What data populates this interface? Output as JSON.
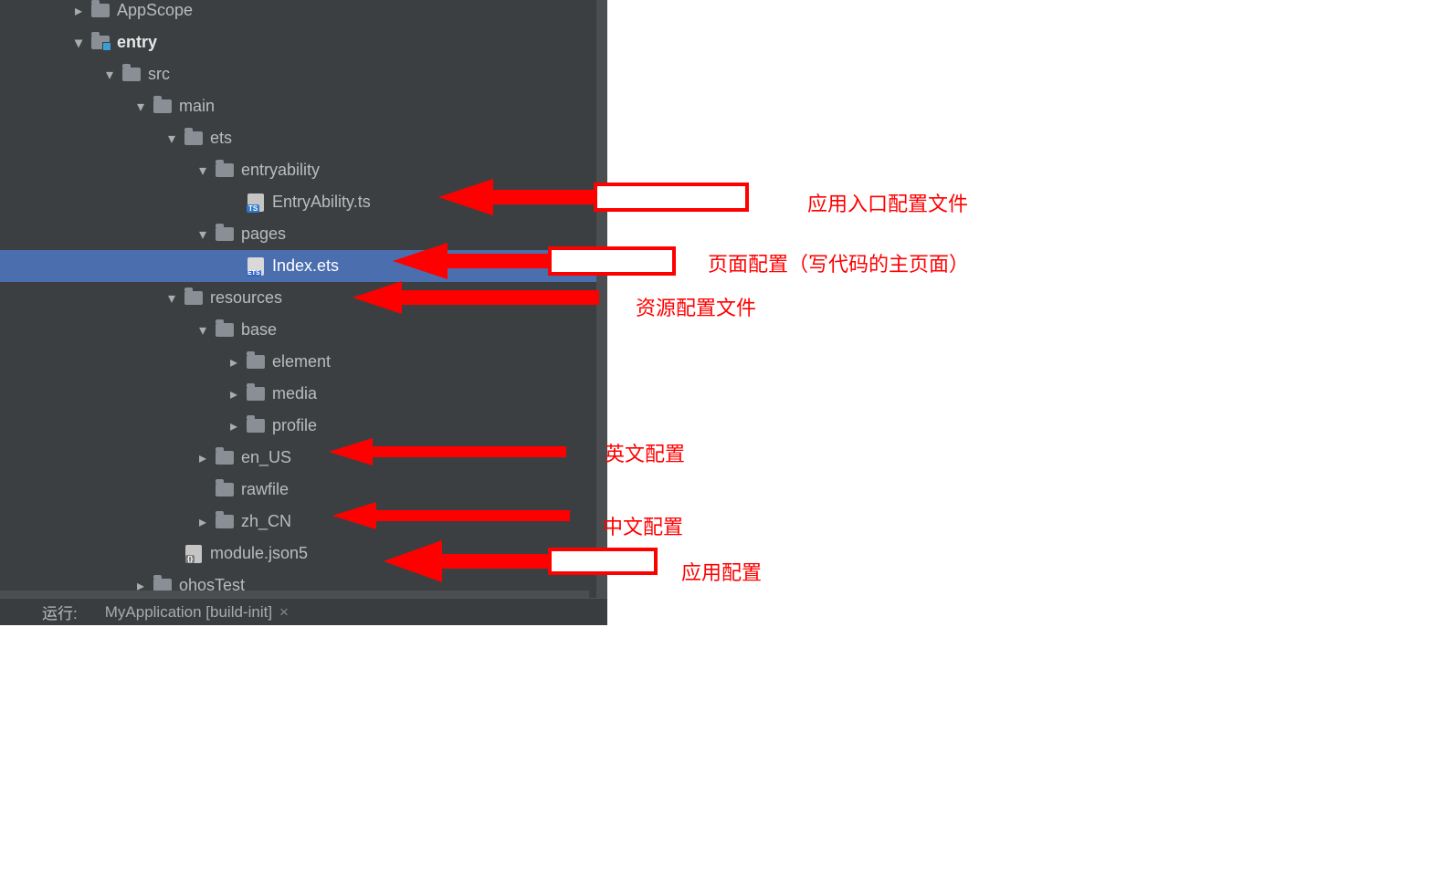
{
  "tree": {
    "appscope": "AppScope",
    "entry": "entry",
    "src": "src",
    "main": "main",
    "ets": "ets",
    "entryability": "entryability",
    "entryAbilityTs": "EntryAbility.ts",
    "pages": "pages",
    "indexEts": "Index.ets",
    "resources": "resources",
    "base": "base",
    "element": "element",
    "media": "media",
    "profile": "profile",
    "en_US": "en_US",
    "rawfile": "rawfile",
    "zh_CN": "zh_CN",
    "moduleJson5": "module.json5",
    "ohosTest": "ohosTest"
  },
  "bottom": {
    "label_left": "运行:",
    "label_right": "MyApplication [build-init]"
  },
  "annotations": {
    "a1": "应用入口配置文件",
    "a2": "页面配置（写代码的主页面）",
    "a3": "资源配置文件",
    "a4": "英文配置",
    "a5": "中文配置",
    "a6": "应用配置"
  }
}
